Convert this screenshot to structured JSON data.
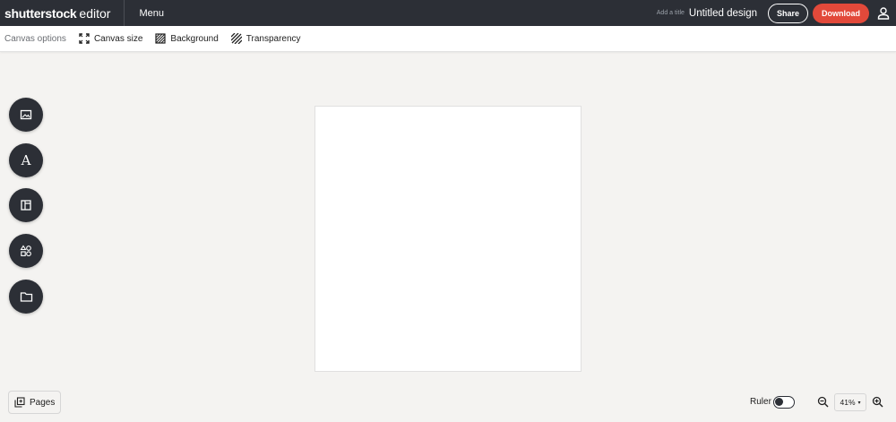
{
  "header": {
    "logo_brand": "shutterstock",
    "logo_product": "editor",
    "menu_label": "Menu",
    "add_title_label": "Add a title",
    "design_title": "Untitled design",
    "share_label": "Share",
    "download_label": "Download",
    "user_icon": "user-icon"
  },
  "toolbar": {
    "label": "Canvas options",
    "items": [
      {
        "label": "Canvas size",
        "icon": "expand-icon"
      },
      {
        "label": "Background",
        "icon": "background-pattern-icon"
      },
      {
        "label": "Transparency",
        "icon": "transparency-stripes-icon"
      }
    ]
  },
  "left_rail": {
    "buttons": [
      {
        "name": "photos",
        "icon": "image-icon"
      },
      {
        "name": "text",
        "icon": "text-icon",
        "glyph": "A"
      },
      {
        "name": "templates",
        "icon": "layout-icon"
      },
      {
        "name": "elements",
        "icon": "shapes-icon"
      },
      {
        "name": "uploads",
        "icon": "folder-icon"
      }
    ]
  },
  "footer": {
    "pages_label": "Pages",
    "ruler_label": "Ruler",
    "ruler_enabled": false,
    "zoom_value": "41%",
    "zoom_caret": "▾"
  },
  "colors": {
    "topbar_bg": "#2c2f36",
    "download_accent": "#e2493a",
    "workspace_bg": "#f4f3f1",
    "canvas_bg": "#ffffff"
  }
}
